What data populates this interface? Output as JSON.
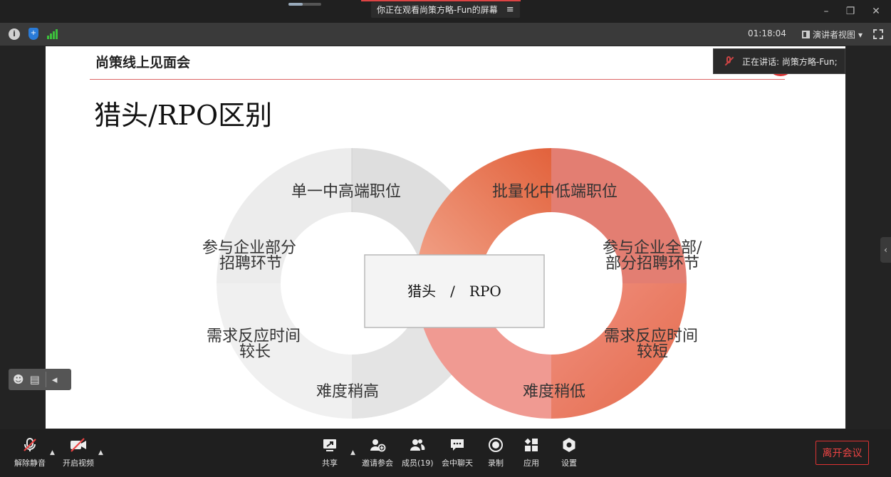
{
  "titlebar": {
    "share_banner": "你正在观看尚策方略-Fun的屏幕",
    "menu_icon": "≡",
    "minimize": "–",
    "restore": "❐",
    "close": "✕"
  },
  "toolbar": {
    "info_icon": "i",
    "shield_icon": "+",
    "clock": "01:18:04",
    "view_mode": "演讲者视图",
    "view_caret": "▾"
  },
  "speaker": {
    "label": "正在讲话: 尚策方略-Fun;"
  },
  "slide": {
    "header": "尚策线上见面会",
    "title": "猎头/RPO区别",
    "center_text": "猎头　/　RPO",
    "left_ring": {
      "top": "单一中高端职位",
      "upper_left": [
        "参与企业部分",
        "招聘环节"
      ],
      "lower_left": [
        "需求反应时间",
        "较长"
      ],
      "bottom": "难度稍高"
    },
    "right_ring": {
      "top": "批量化中低端职位",
      "upper_right": [
        "参与企业全部/",
        "部分招聘环节"
      ],
      "lower_right": [
        "需求反应时间",
        "较短"
      ],
      "bottom": "难度稍低"
    },
    "colors": {
      "left_ring_light": "#ececec",
      "left_ring_dark": "#d8d8d8",
      "right_ring_orange": "#e86a44",
      "right_ring_salmon": "#ec8a7c",
      "accent_red": "#d33333"
    }
  },
  "side_collapse": "‹",
  "mini_tools": {
    "emoji": "☻",
    "chat": "▤",
    "collapse": "◂"
  },
  "bottombar": {
    "unmute": "解除静音",
    "start_video": "开启视频",
    "share": "共享",
    "invite": "邀请参会",
    "members": "成员(19)",
    "chat": "会中聊天",
    "record": "录制",
    "apps": "应用",
    "settings": "设置",
    "leave": "离开会议",
    "caret": "▲"
  }
}
